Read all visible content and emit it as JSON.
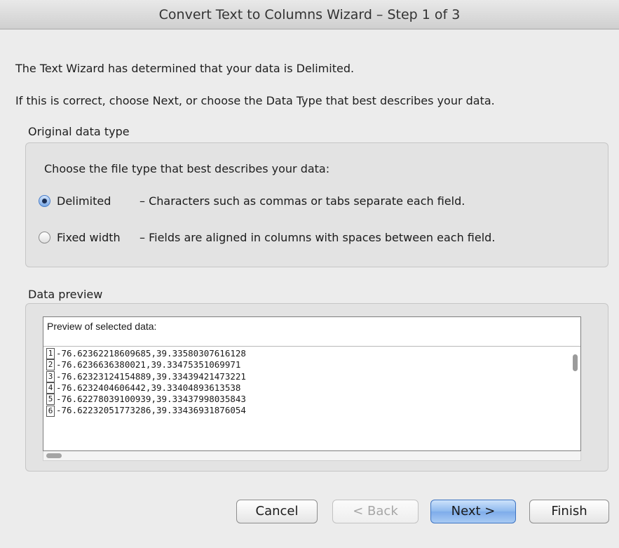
{
  "window": {
    "title": "Convert Text to Columns Wizard – Step 1 of 3"
  },
  "intro": {
    "line1": "The Text Wizard has determined that your data is Delimited.",
    "line2": "If this is correct, choose Next, or choose the Data Type that best describes your data."
  },
  "original_data_type": {
    "label": "Original data type",
    "prompt": "Choose the file type that best describes your data:",
    "options": [
      {
        "label": "Delimited",
        "description": "– Characters such as commas or tabs separate each field.",
        "selected": true
      },
      {
        "label": "Fixed width",
        "description": "– Fields are aligned in columns with spaces between each field.",
        "selected": false
      }
    ]
  },
  "data_preview": {
    "label": "Data preview",
    "header": "Preview of selected data:",
    "rows": [
      {
        "num": "1",
        "text": "-76.62362218609685,39.33580307616128"
      },
      {
        "num": "2",
        "text": "-76.6236636380021,39.33475351069971"
      },
      {
        "num": "3",
        "text": "-76.62323124154889,39.33439421473221"
      },
      {
        "num": "4",
        "text": "-76.6232404606442,39.33404893613538"
      },
      {
        "num": "5",
        "text": "-76.62278039100939,39.33437998035843"
      },
      {
        "num": "6",
        "text": "-76.62232051773286,39.33436931876054"
      }
    ]
  },
  "buttons": {
    "cancel": "Cancel",
    "back": "< Back",
    "next": "Next >",
    "finish": "Finish"
  }
}
